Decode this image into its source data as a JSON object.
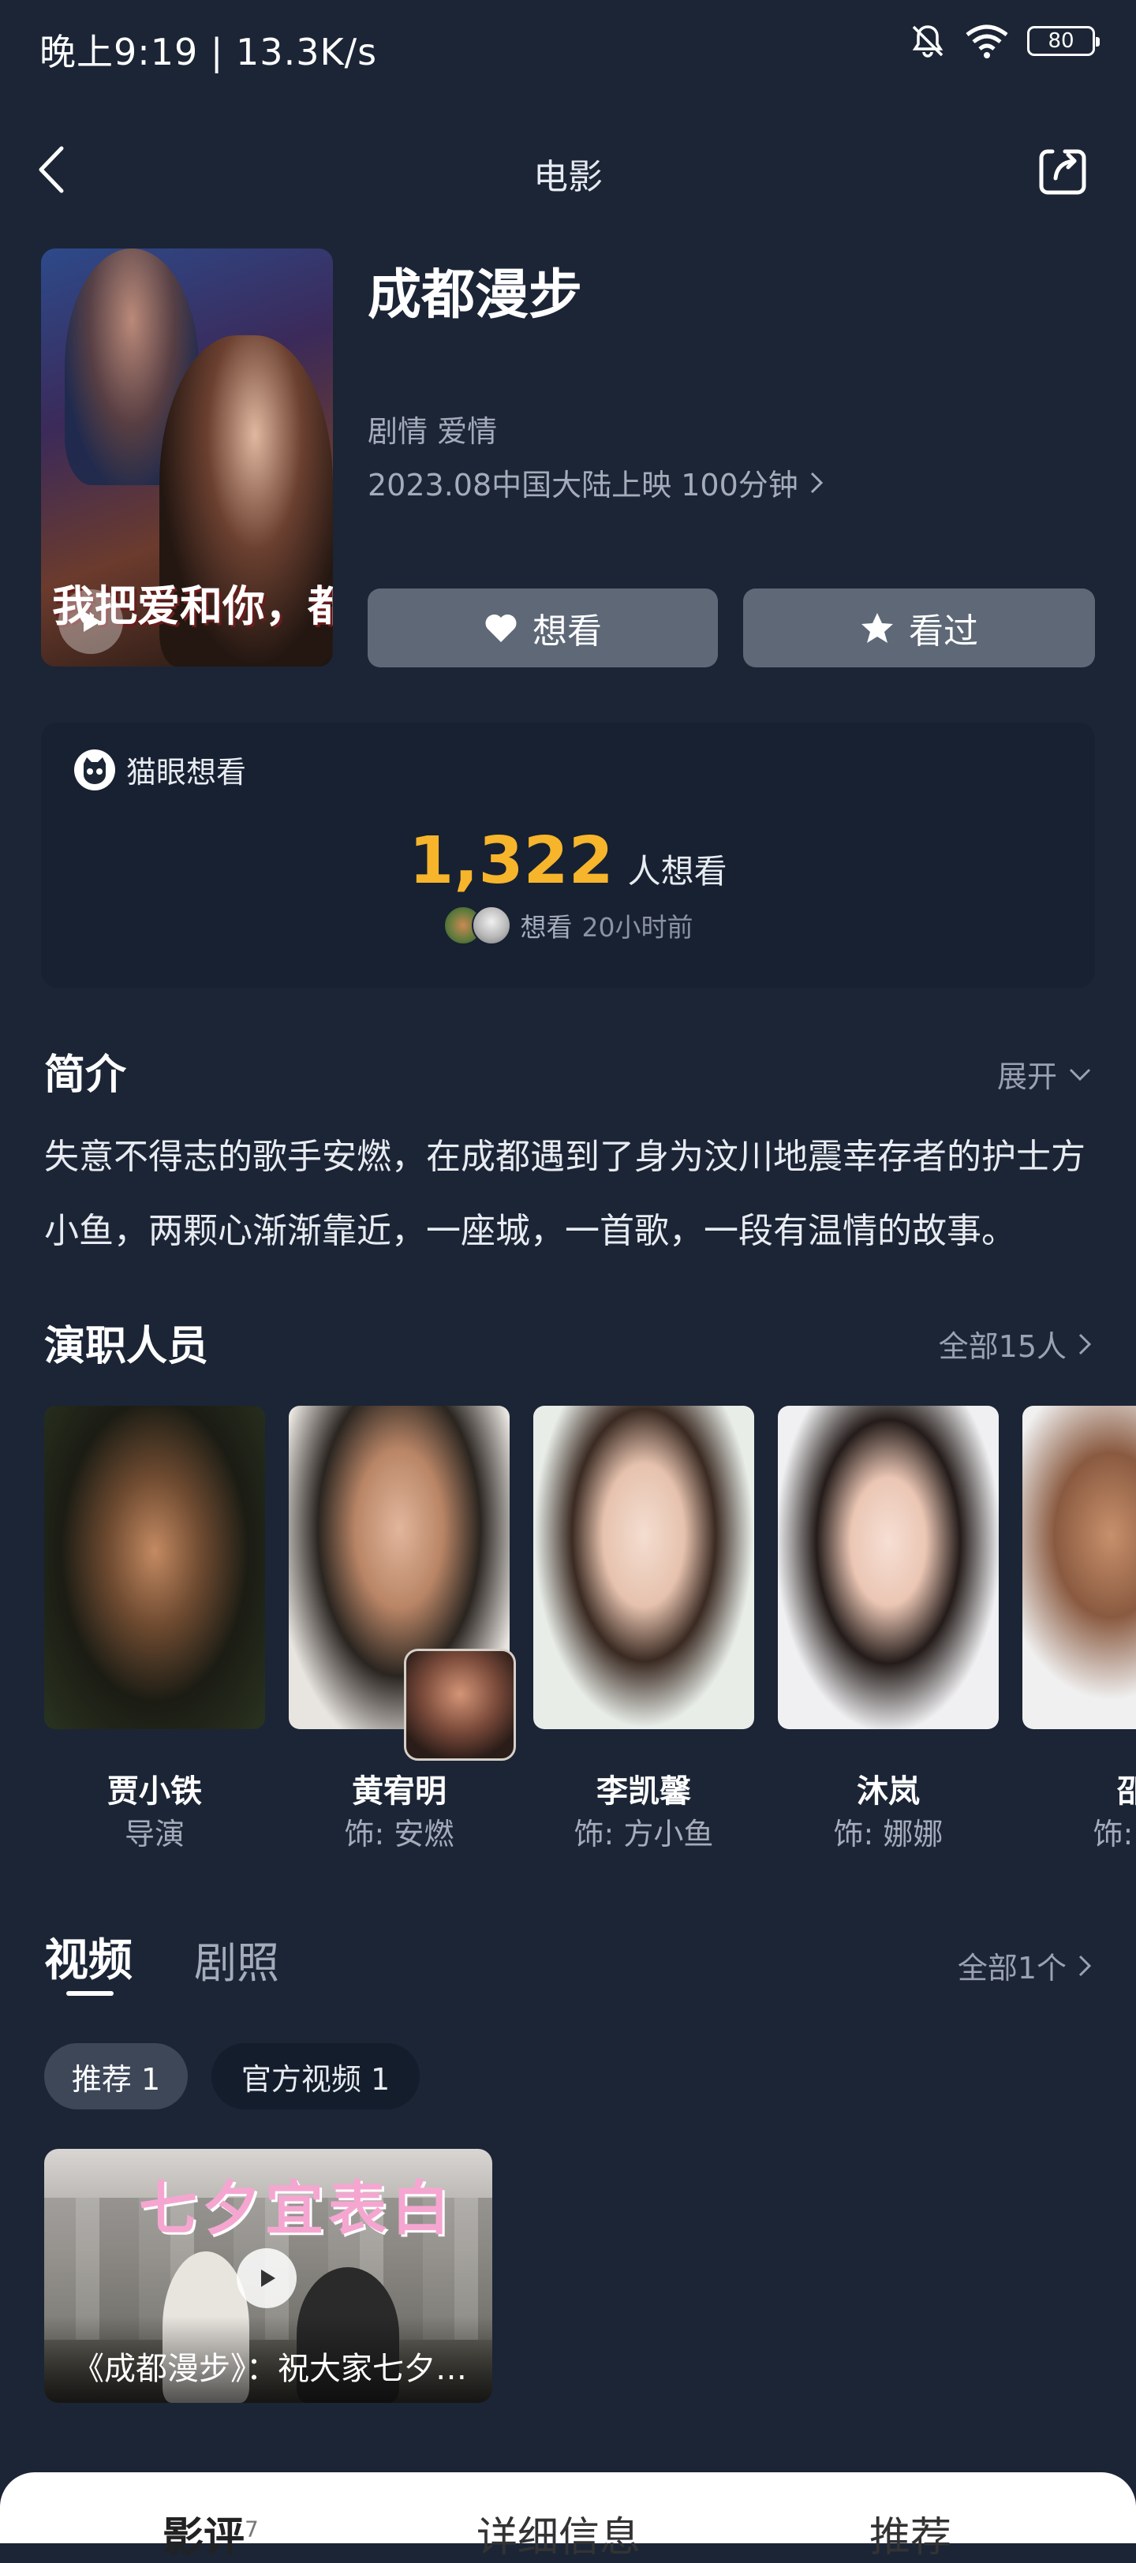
{
  "status_bar": {
    "time": "晚上9:19 | 13.3K/s",
    "battery": "80"
  },
  "header": {
    "title": "电影"
  },
  "movie": {
    "title": "成都漫步",
    "genres": "剧情 爱情",
    "release": "2023.08中国大陆上映 100分钟",
    "poster_text": "我把爱和你，都丢丢了"
  },
  "actions": {
    "want": "想看",
    "seen": "看过"
  },
  "want_card": {
    "brand": "猫眼想看",
    "count": "1,322",
    "count_label": "人想看",
    "sub_action": "想看",
    "sub_time": "20小时前"
  },
  "intro": {
    "title": "简介",
    "expand": "展开",
    "text": "失意不得志的歌手安燃，在成都遇到了身为汶川地震幸存者的护士方小鱼，两颗心渐渐靠近，一座城，一首歌，一段有温情的故事。"
  },
  "cast": {
    "title": "演职人员",
    "all": "全部15人",
    "members": [
      {
        "name": "贾小铁",
        "role": "导演"
      },
      {
        "name": "黄宥明",
        "role": "饰: 安燃"
      },
      {
        "name": "李凯馨",
        "role": "饰: 方小鱼"
      },
      {
        "name": "沐岚",
        "role": "饰: 娜娜"
      },
      {
        "name": "邵",
        "role": "饰: 老"
      }
    ]
  },
  "video": {
    "tab_video": "视频",
    "tab_stills": "剧照",
    "all": "全部1个",
    "chip_recommend": "推荐 1",
    "chip_official": "官方视频 1",
    "card_title": "七夕宜表白",
    "card_caption": "《成都漫步》：祝大家七夕快乐"
  },
  "bottom_tabs": {
    "reviews": "影评",
    "reviews_count": "7",
    "detail": "详细信息",
    "recommend": "推荐"
  },
  "colors": {
    "background": "#1b2536",
    "accent": "#f7b52c",
    "button": "#5e6877"
  }
}
